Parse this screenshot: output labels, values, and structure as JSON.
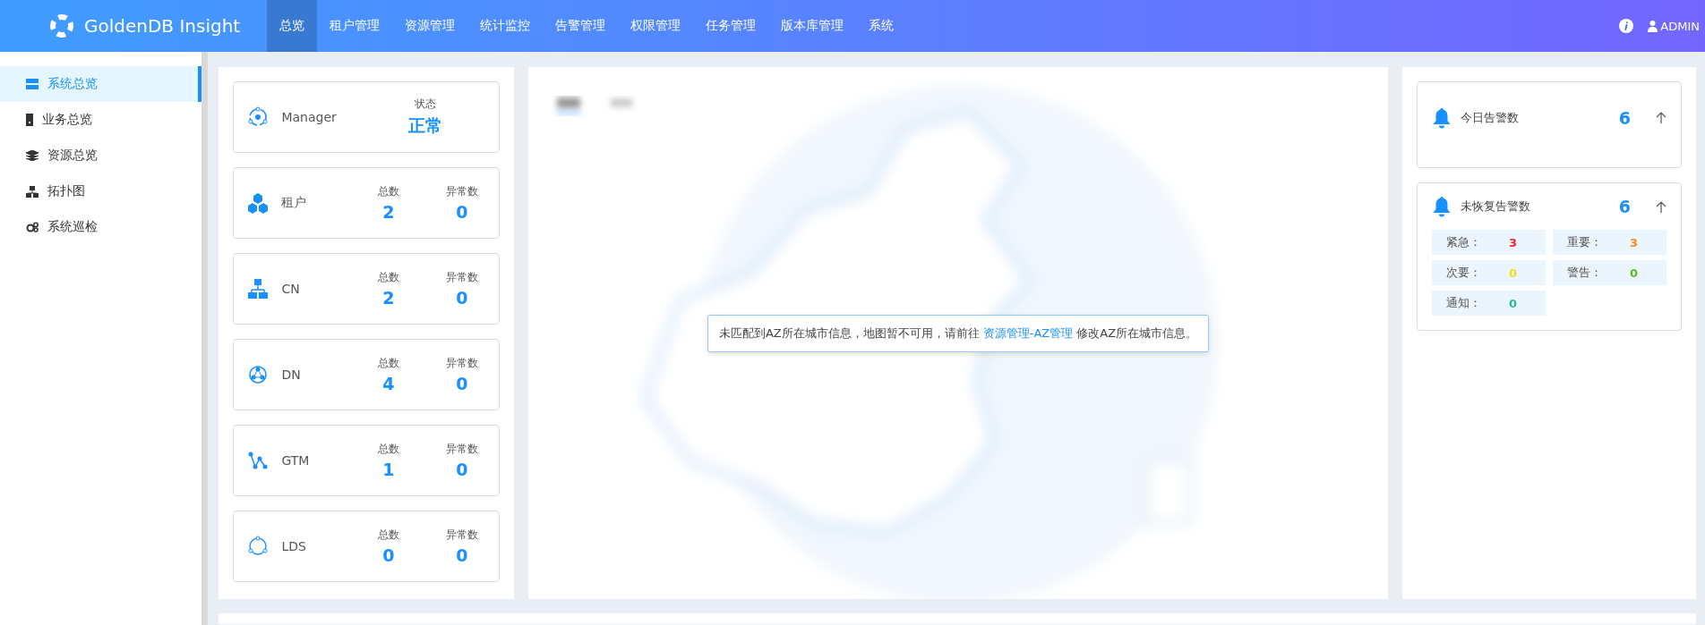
{
  "header": {
    "logo": "GoldenDB Insight",
    "nav": [
      {
        "label": "总览",
        "selected": true
      },
      {
        "label": "租户管理",
        "selected": false
      },
      {
        "label": "资源管理",
        "selected": false
      },
      {
        "label": "统计监控",
        "selected": false
      },
      {
        "label": "告警管理",
        "selected": false
      },
      {
        "label": "权限管理",
        "selected": false
      },
      {
        "label": "任务管理",
        "selected": false
      },
      {
        "label": "版本库管理",
        "selected": false
      },
      {
        "label": "系统",
        "selected": false
      }
    ],
    "user": "ADMIN"
  },
  "sidebar": {
    "items": [
      {
        "label": "系统总览",
        "selected": true
      },
      {
        "label": "业务总览",
        "selected": false
      },
      {
        "label": "资源总览",
        "selected": false
      },
      {
        "label": "拓扑图",
        "selected": false
      },
      {
        "label": "系统巡检",
        "selected": false
      }
    ]
  },
  "components": [
    {
      "kind": "status",
      "name": "Manager",
      "status_label": "状态",
      "status": "正常"
    },
    {
      "kind": "counts",
      "name": "租户",
      "total_label": "总数",
      "total": "2",
      "abnormal_label": "异常数",
      "abnormal": "0"
    },
    {
      "kind": "counts",
      "name": "CN",
      "total_label": "总数",
      "total": "2",
      "abnormal_label": "异常数",
      "abnormal": "0"
    },
    {
      "kind": "counts",
      "name": "DN",
      "total_label": "总数",
      "total": "4",
      "abnormal_label": "异常数",
      "abnormal": "0"
    },
    {
      "kind": "counts",
      "name": "GTM",
      "total_label": "总数",
      "total": "1",
      "abnormal_label": "异常数",
      "abnormal": "0"
    },
    {
      "kind": "counts",
      "name": "LDS",
      "total_label": "总数",
      "total": "0",
      "abnormal_label": "异常数",
      "abnormal": "0"
    }
  ],
  "map": {
    "notice": "未匹配到AZ所在城市信息，地图暂不可用，请前往",
    "link": "资源管理-AZ管理",
    "notice_end": "修改AZ所在城市信息。"
  },
  "alarms": {
    "today": {
      "label": "今日告警数",
      "count": "6"
    },
    "unrecovered": {
      "label": "未恢复告警数",
      "count": "6",
      "levels": [
        {
          "label": "紧急：",
          "count": "3",
          "color": "#f5222d"
        },
        {
          "label": "重要：",
          "count": "3",
          "color": "#fa8c16"
        },
        {
          "label": "次要：",
          "count": "0",
          "color": "#fadb14"
        },
        {
          "label": "警告：",
          "count": "0",
          "color": "#52c41a"
        },
        {
          "label": "通知：",
          "count": "0",
          "color": "#2db7a0"
        }
      ]
    }
  }
}
